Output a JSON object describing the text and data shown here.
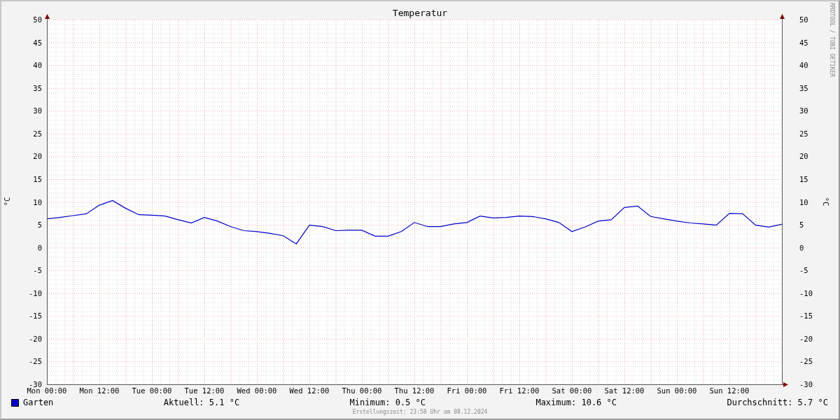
{
  "graph": {
    "credit": "RRDTOOL / TOBI OETIKER",
    "right_axis": {
      "label": "°C",
      "ticks": [
        "50",
        "45",
        "40",
        "35",
        "30",
        "25",
        "20",
        "15",
        "10",
        "5",
        "0",
        "-5",
        "-10",
        "-15",
        "-20",
        "-25",
        "-30"
      ]
    },
    "chart_data": {
      "type": "line",
      "title": "Temperatur",
      "ylabel": "°C",
      "categories": [
        "Mon 00:00",
        null,
        null,
        null,
        "Mon 12:00",
        null,
        null,
        null,
        "Tue 00:00",
        null,
        null,
        null,
        "Tue 12:00",
        null,
        null,
        null,
        "Wed 00:00",
        null,
        null,
        null,
        "Wed 12:00",
        null,
        null,
        null,
        "Thu 00:00",
        null,
        null,
        null,
        "Thu 12:00",
        null,
        null,
        null,
        "Fri 00:00",
        null,
        null,
        null,
        "Fri 12:00",
        null,
        null,
        null,
        "Sat 00:00",
        null,
        null,
        null,
        "Sat 12:00",
        null,
        null,
        null,
        "Sun 00:00",
        null,
        null,
        null,
        "Sun 12:00",
        null,
        null,
        null,
        null
      ],
      "series": [
        {
          "name": "Garten",
          "color": "#0000cc",
          "values": [
            6.3,
            6.6,
            7.0,
            7.4,
            9.3,
            10.3,
            8.6,
            7.2,
            7.1,
            6.9,
            6.1,
            5.4,
            6.6,
            5.8,
            4.6,
            3.7,
            3.5,
            3.1,
            2.6,
            0.8,
            4.9,
            4.6,
            3.7,
            3.8,
            3.8,
            2.5,
            2.5,
            3.5,
            5.5,
            4.6,
            4.6,
            5.2,
            5.5,
            6.9,
            6.5,
            6.6,
            6.9,
            6.8,
            6.3,
            5.5,
            3.5,
            4.5,
            5.8,
            6.1,
            8.8,
            9.1,
            6.8,
            6.3,
            5.8,
            5.4,
            5.2,
            4.9,
            7.5,
            7.4,
            4.9,
            4.5,
            5.1
          ]
        }
      ],
      "ylim": [
        -30,
        50
      ],
      "grid": true,
      "yticks": [
        {
          "value": 50,
          "label": "50"
        },
        {
          "value": 45,
          "label": "45"
        },
        {
          "value": 40,
          "label": "40"
        },
        {
          "value": 35,
          "label": "35"
        },
        {
          "value": 30,
          "label": "30"
        },
        {
          "value": 25,
          "label": "25"
        },
        {
          "value": 20,
          "label": "20"
        },
        {
          "value": 15,
          "label": "15"
        },
        {
          "value": 10,
          "label": "10"
        },
        {
          "value": 5,
          "label": "5"
        },
        {
          "value": 0,
          "label": "0"
        },
        {
          "value": -5,
          "label": "-5"
        },
        {
          "value": -10,
          "label": "-10"
        },
        {
          "value": -15,
          "label": "-15"
        },
        {
          "value": -20,
          "label": "-20"
        },
        {
          "value": -25,
          "label": "-25"
        },
        {
          "value": -30,
          "label": "-30"
        }
      ]
    }
  },
  "legend": {
    "stats": [
      "Aktuell: 5.1 °C",
      "Minimum: 0.5 °C",
      "Maximum: 10.6 °C",
      "Durchschnitt: 5.7 °C"
    ]
  },
  "footer": "Erstellungszeit: 23:58 Uhr am 08.12.2024"
}
